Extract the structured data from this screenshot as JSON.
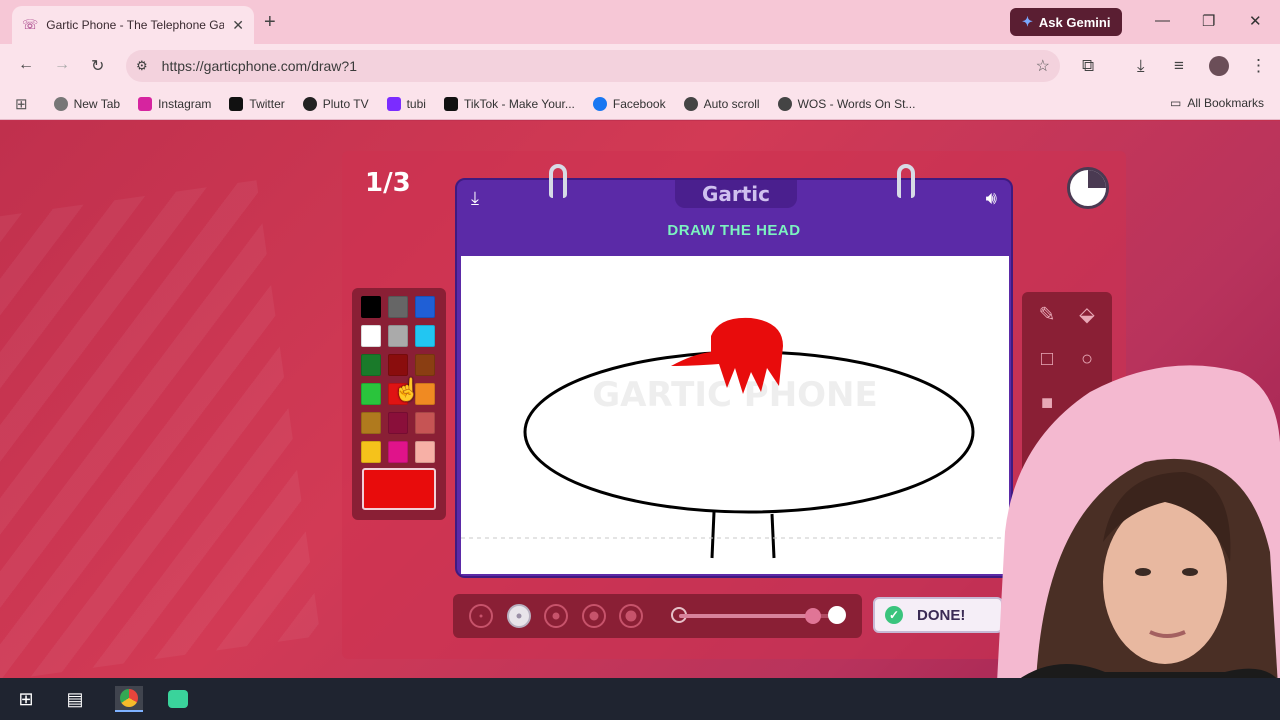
{
  "browser": {
    "tab_title": "Gartic Phone - The Telephone Game",
    "url": "https://garticphone.com/draw?1",
    "gemini_label": "Ask Gemini",
    "bookmarks": [
      {
        "label": "New Tab",
        "color": "#555555"
      },
      {
        "label": "Instagram",
        "color": "#d6249f"
      },
      {
        "label": "Twitter",
        "color": "#111111"
      },
      {
        "label": "Pluto TV",
        "color": "#222222"
      },
      {
        "label": "tubi",
        "color": "#7b2cff"
      },
      {
        "label": "TikTok - Make Your...",
        "color": "#111111"
      },
      {
        "label": "Facebook",
        "color": "#1877f2"
      },
      {
        "label": "Auto scroll",
        "color": "#444444"
      },
      {
        "label": "WOS - Words On St...",
        "color": "#444444"
      }
    ],
    "all_bookmarks": "All Bookmarks"
  },
  "game": {
    "round": "1/3",
    "logo": "Gartic",
    "prompt": "DRAW THE HEAD",
    "watermark": "GARTIC PHONE",
    "done_label": "DONE!",
    "current_color": "#e80c0c",
    "palette": [
      "#000000",
      "#666666",
      "#1f5fd6",
      "#ffffff",
      "#aaaaaa",
      "#22c6f2",
      "#1a7a2a",
      "#8a0d0d",
      "#8a3e12",
      "#2ac43c",
      "#e01313",
      "#f08a22",
      "#b07a1e",
      "#8a0f3a",
      "#c65454",
      "#f5c21b",
      "#e0138a",
      "#f7b0a6"
    ],
    "brush_sizes": 5,
    "selected_brush_index": 1,
    "opacity_level": 0.85
  }
}
